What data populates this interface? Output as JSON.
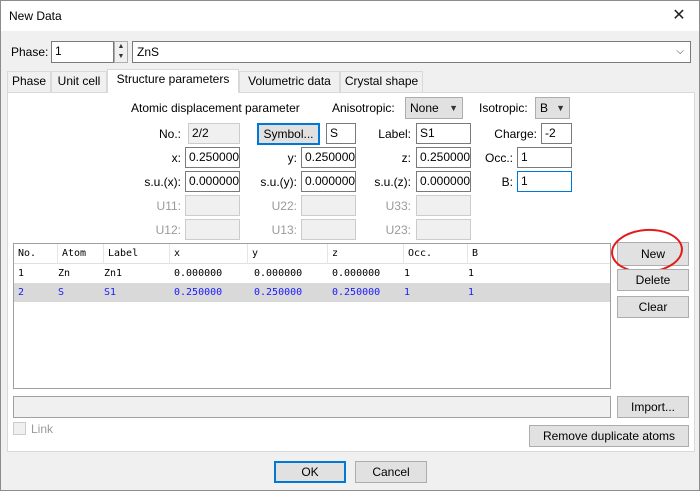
{
  "window": {
    "title": "New Data",
    "close_glyph": "✕"
  },
  "phase": {
    "label": "Phase:",
    "number": "1",
    "name": "ZnS"
  },
  "tabs": [
    "Phase",
    "Unit cell",
    "Structure parameters",
    "Volumetric data",
    "Crystal shape"
  ],
  "adp": {
    "title": "Atomic displacement parameter",
    "aniso_label": "Anisotropic:",
    "aniso_value": "None",
    "iso_label": "Isotropic:",
    "iso_value": "B"
  },
  "form": {
    "no_label": "No.:",
    "no_value": "2/2",
    "symbol_button": "Symbol...",
    "symbol_value": "S",
    "label_label": "Label:",
    "label_value": "S1",
    "charge_label": "Charge:",
    "charge_value": "-2",
    "x_label": "x:",
    "x_value": "0.250000",
    "y_label": "y:",
    "y_value": "0.250000",
    "z_label": "z:",
    "z_value": "0.250000",
    "occ_label": "Occ.:",
    "occ_value": "1",
    "sux_label": "s.u.(x):",
    "sux_value": "0.000000",
    "suy_label": "s.u.(y):",
    "suy_value": "0.000000",
    "suz_label": "s.u.(z):",
    "suz_value": "0.000000",
    "b_label": "B:",
    "b_value": "1",
    "u11_label": "U11:",
    "u22_label": "U22:",
    "u33_label": "U33:",
    "u12_label": "U12:",
    "u13_label": "U13:",
    "u23_label": "U23:"
  },
  "table": {
    "columns": [
      "No.",
      "Atom",
      "Label",
      "x",
      "y",
      "z",
      "Occ.",
      "B"
    ],
    "rows": [
      [
        "1",
        "Zn",
        "Zn1",
        "0.000000",
        "0.000000",
        "0.000000",
        "1",
        "1"
      ],
      [
        "2",
        "S",
        "S1",
        "0.250000",
        "0.250000",
        "0.250000",
        "1",
        "1"
      ]
    ],
    "selected_row": 2
  },
  "buttons": {
    "new": "New",
    "delete": "Delete",
    "clear": "Clear",
    "import": "Import...",
    "remove_duplicates": "Remove duplicate atoms",
    "ok": "OK",
    "cancel": "Cancel"
  },
  "link_label": "Link",
  "colors": {
    "accent": "#0078d7",
    "annotation": "#e31a1a",
    "selected_text": "#1a1aff"
  }
}
